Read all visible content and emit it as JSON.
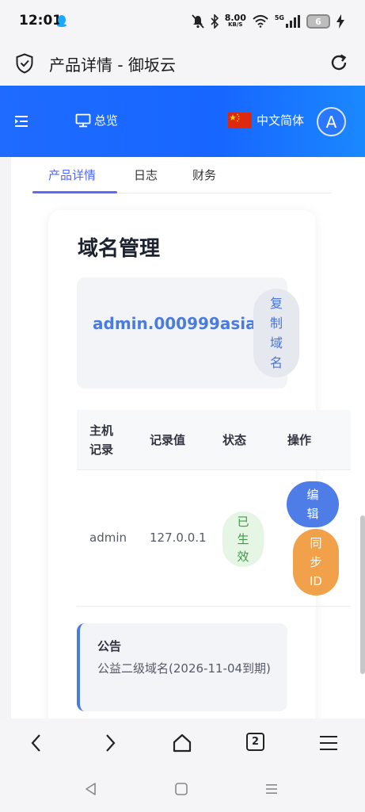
{
  "status_bar": {
    "time": "12:01",
    "net_speed_value": "8.00",
    "net_speed_unit": "KB/S",
    "network_type": "5G",
    "battery_level": "6"
  },
  "browser": {
    "page_title": "产品详情 - 御坂云",
    "tab_count": "2"
  },
  "header": {
    "overview_label": "总览",
    "language_label": "中文简体",
    "avatar_initial": "A"
  },
  "tabs": [
    {
      "label": "产品详情",
      "active": true
    },
    {
      "label": "日志",
      "active": false
    },
    {
      "label": "财务",
      "active": false
    }
  ],
  "domain_card": {
    "title": "域名管理",
    "domain": "admin.000999asia",
    "copy_label": [
      "复",
      "制",
      "域",
      "名"
    ]
  },
  "records_table": {
    "headers": {
      "host": [
        "主机",
        "记录"
      ],
      "value": "记录值",
      "status": "状态",
      "action": "操作"
    },
    "rows": [
      {
        "host": "admin",
        "value": "127.0.0.1",
        "status": [
          "已",
          "生",
          "效"
        ],
        "edit_label": [
          "编",
          "辑"
        ],
        "sync_label": [
          "同",
          "步",
          "ID"
        ]
      }
    ]
  },
  "notice": {
    "title": "公告",
    "body": "公益二级域名(2026-11-04到期)"
  },
  "colors": {
    "header_blue": "#1766ff",
    "link_blue": "#4a7bde",
    "success_green": "#3f9a48",
    "sync_orange": "#f0a14a",
    "active_tab": "#4f66ff"
  }
}
